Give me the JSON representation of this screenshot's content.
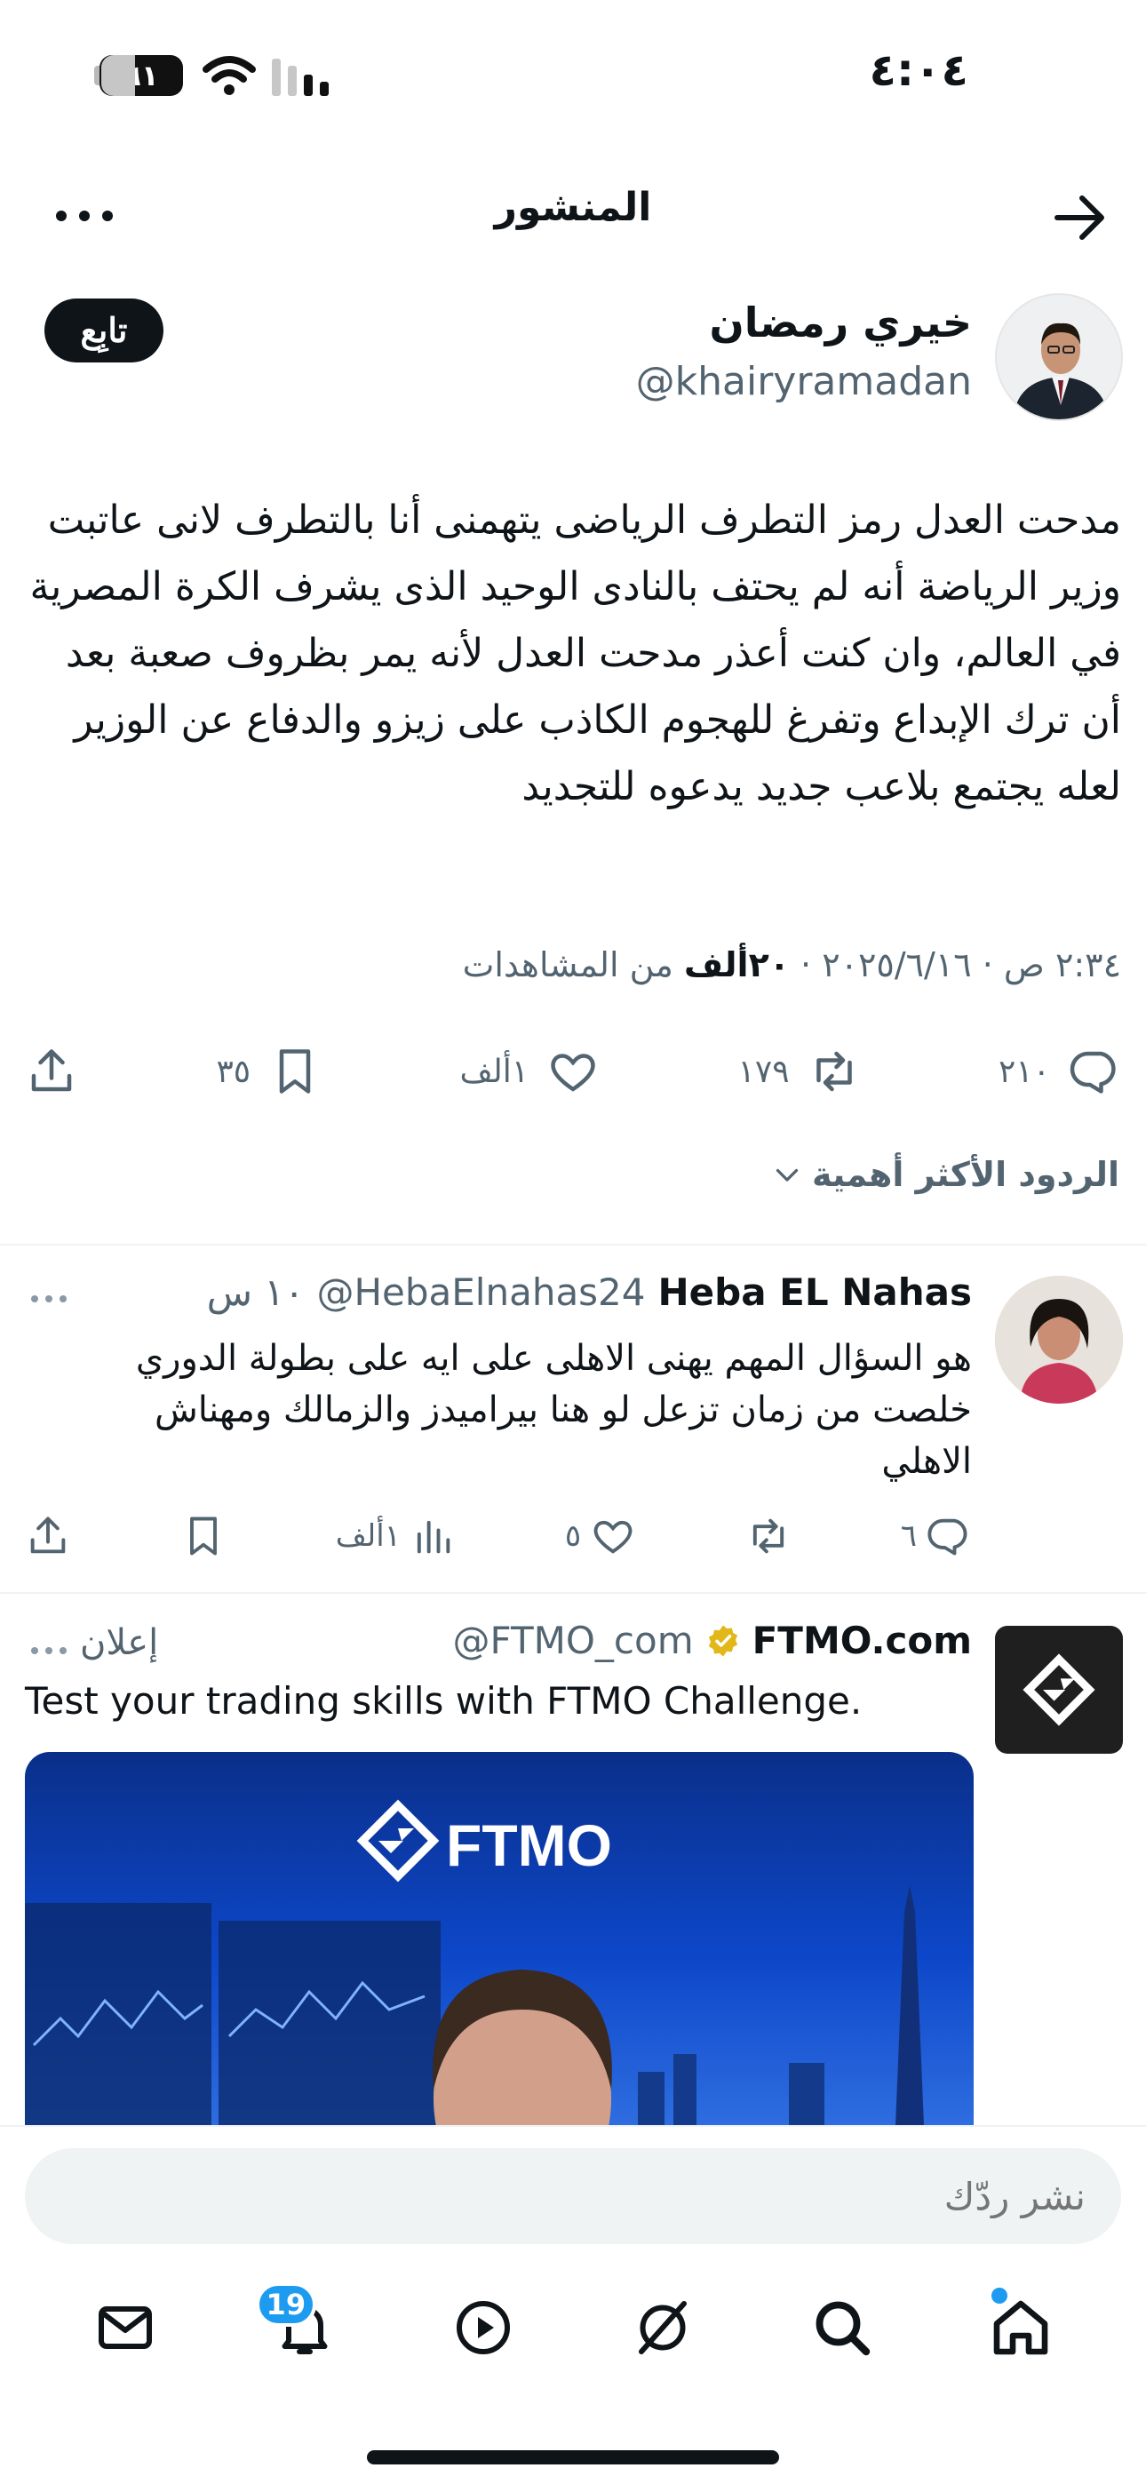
{
  "status_bar": {
    "time": "٤:٠٤",
    "battery": "٦١"
  },
  "header": {
    "title": "المنشور"
  },
  "post": {
    "author_name": "خيري رمضان",
    "author_handle": "@khairyramadan",
    "follow_label": "تابِع",
    "body": "مدحت العدل رمز التطرف الرياضى يتهمنى أنا بالتطرف لانى عاتبت وزير الرياضة أنه لم يحتف بالنادى الوحيد الذى يشرف الكرة المصرية في العالم، وان كنت أعذر مدحت العدل لأنه يمر بظروف صعبة بعد أن ترك الإبداع وتفرغ للهجوم الكاذب على زيزو والدفاع عن الوزير لعله يجتمع بلاعب جديد يدعوه للتجديد",
    "datetime": "٢:٣٤ ص · ٢٠٢٥/٦/١٦ · ",
    "views_count": "٢٠ألف",
    "views_label": " من المشاهدات",
    "replies": "٢١٠",
    "reposts": "١٧٩",
    "likes": "١ألف",
    "bookmarks": "٣٥"
  },
  "sort": {
    "label": "الردود الأكثر أهمية"
  },
  "reply": {
    "author_name": "Heba EL Nahas",
    "author_handle": "@HebaElnahas24",
    "time": "١٠ س",
    "body": "هو السؤال المهم يهنى الاهلى على ايه على بطولة الدوري خلصت من زمان تزعل لو هنا بيراميدز والزمالك ومهناش الاهلي",
    "replies": "٦",
    "likes": "٥",
    "views": "١ألف"
  },
  "ad": {
    "author_name": "FTMO.com",
    "author_handle": "@FTMO_com",
    "ad_label": "إعلان",
    "text": "Test your trading skills with FTMO Challenge.",
    "image_brand": "FTMO"
  },
  "composer": {
    "placeholder": "نشر ردّك"
  },
  "nav": {
    "notifications_badge": "19"
  },
  "colors": {
    "accent": "#1d9bf0",
    "text": "#0f1419",
    "muted": "#536471",
    "verified": "#e2b719"
  }
}
